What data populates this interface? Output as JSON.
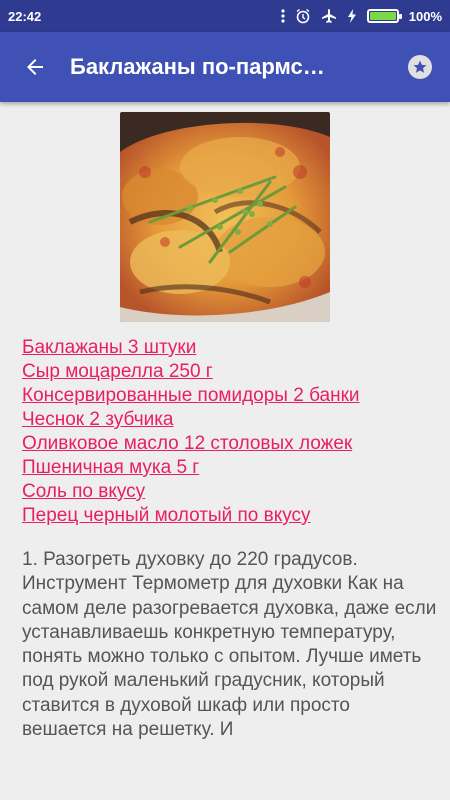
{
  "status_bar": {
    "time": "22:42",
    "battery": "100%",
    "icons": [
      "dots-icon",
      "alarm-icon",
      "airplane-icon",
      "charging-icon",
      "battery-icon"
    ]
  },
  "app_bar": {
    "title": "Баклажаны по-пармс…",
    "back_icon": "arrow-back-icon",
    "favorite_icon": "star-icon"
  },
  "recipe": {
    "image": "eggplant-parmesan-photo",
    "ingredients": [
      "Баклажаны 3 штуки",
      "Сыр моцарелла 250 г",
      "Консервированные помидоры 2 банки",
      "Чеснок 2 зубчика",
      "Оливковое масло 12 столовых ложек",
      "Пшеничная мука 5 г",
      "Соль по вкусу",
      "Перец черный молотый по вкусу"
    ],
    "instructions": "1. Разогреть духовку до 220 градусов. Инструмент Термометр для духовки Как на самом деле разогревается духовка, даже если устанавливаешь конкретную температуру, понять можно только с опытом. Лучше иметь под рукой маленький градусник, который ставится в духовой шкаф или просто вешается на решетку. И"
  },
  "colors": {
    "status_bar": "#2f3b91",
    "app_bar": "#3f51b5",
    "link": "#e91e63",
    "background": "#eeeeee"
  }
}
